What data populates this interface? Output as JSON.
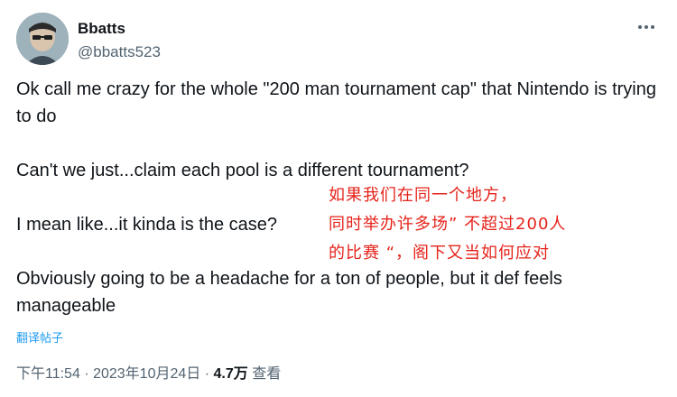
{
  "header": {
    "display_name": "Bbatts",
    "handle": "@bbatts523",
    "more_icon": "more-horizontal-icon"
  },
  "tweet": {
    "paragraph_1": "Ok call me crazy for the whole \"200 man tournament cap\" that Nintendo is trying to do",
    "paragraph_2": "Can't we just...claim each pool is a different tournament?",
    "paragraph_3": "I mean like...it kinda is the case?",
    "paragraph_4": "Obviously going to be a headache for a ton of people, but it def feels manageable"
  },
  "overlay": {
    "line_1": "如果我们在同一个地方，",
    "line_2": "同时举办许多场” 不超过200人",
    "line_3": "的比赛 “，阁下又当如何应对"
  },
  "translate_label": "翻译帖子",
  "meta": {
    "time": "下午11:54",
    "separator_1": " · ",
    "date": "2023年10月24日",
    "separator_2": " · ",
    "views_count": "4.7万",
    "views_label": " 查看"
  },
  "colors": {
    "text": "#0f1419",
    "secondary": "#536471",
    "link": "#1d9bf0",
    "overlay_red": "#e5231b"
  }
}
